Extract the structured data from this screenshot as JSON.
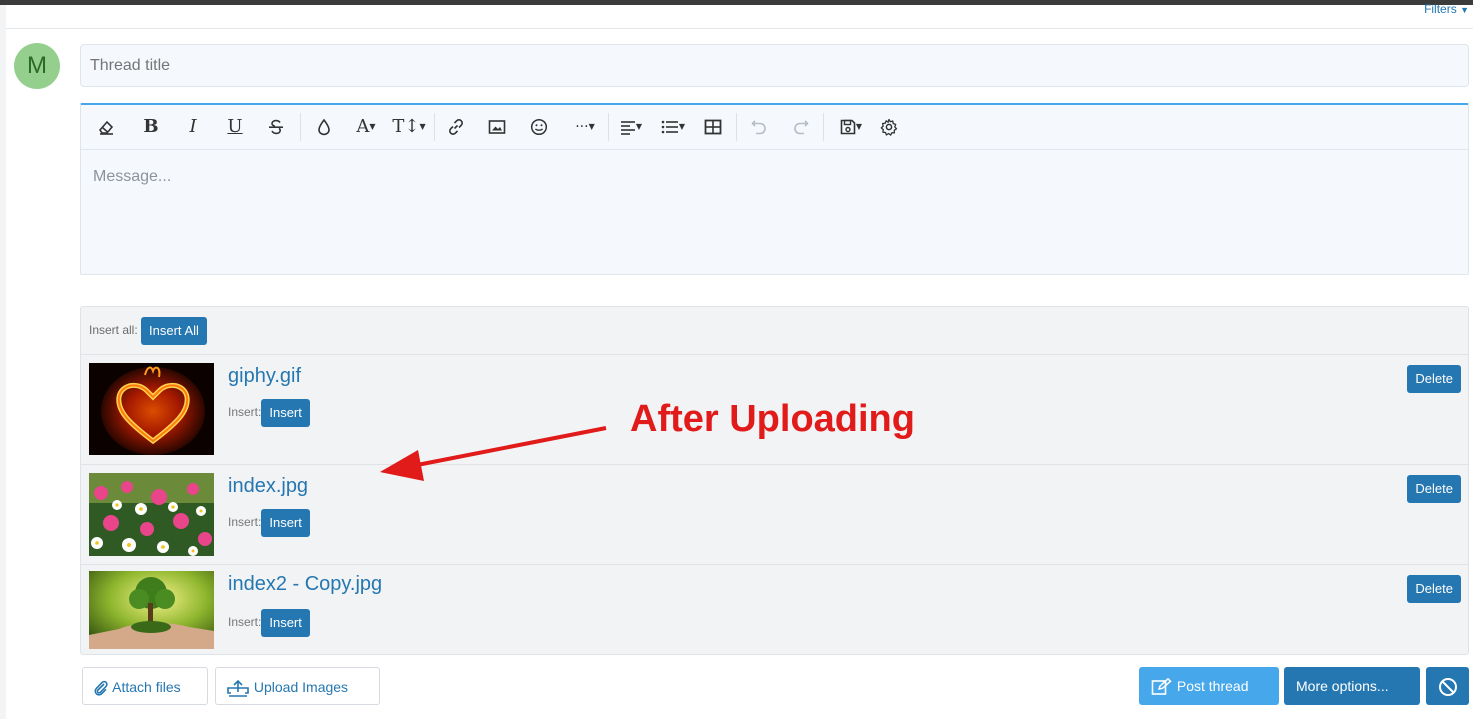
{
  "page": {
    "filters_label": "Filters",
    "avatar_letter": "M"
  },
  "thread": {
    "title_placeholder": "Thread title",
    "message_placeholder": "Message..."
  },
  "toolbar": {
    "items": [
      "clear-formatting-icon",
      "bold-icon",
      "italic-icon",
      "underline-icon",
      "strikethrough-icon",
      "text-color-icon",
      "font-family-icon",
      "font-size-icon",
      "insert-link-icon",
      "insert-image-icon",
      "emoji-icon",
      "more-insert-icon",
      "align-icon",
      "list-icon",
      "table-icon",
      "undo-icon",
      "redo-icon",
      "drafts-icon",
      "toggle-bbcode-icon"
    ],
    "bold_glyph": "B",
    "italic_glyph": "I",
    "underline_glyph": "U",
    "font_glyph": "A",
    "size_glyph": "T↕",
    "more_glyph": "···"
  },
  "attachments": {
    "insert_all_label": "Insert all:",
    "insert_all_button": "Insert All",
    "insert_label": "Insert:",
    "insert_button": "Insert",
    "delete_button": "Delete",
    "files": [
      {
        "name": "giphy.gif"
      },
      {
        "name": "index.jpg"
      },
      {
        "name": "index2 - Copy.jpg"
      }
    ]
  },
  "actions": {
    "attach_files": "Attach files",
    "upload_images": "Upload Images",
    "post_thread": "Post thread",
    "more_options": "More options..."
  },
  "annotation": {
    "text": "After Uploading",
    "color": "#e11a1a"
  },
  "colors": {
    "accent": "#2577b1",
    "post_button": "#47a7eb",
    "editor_border": "#47a7eb"
  }
}
